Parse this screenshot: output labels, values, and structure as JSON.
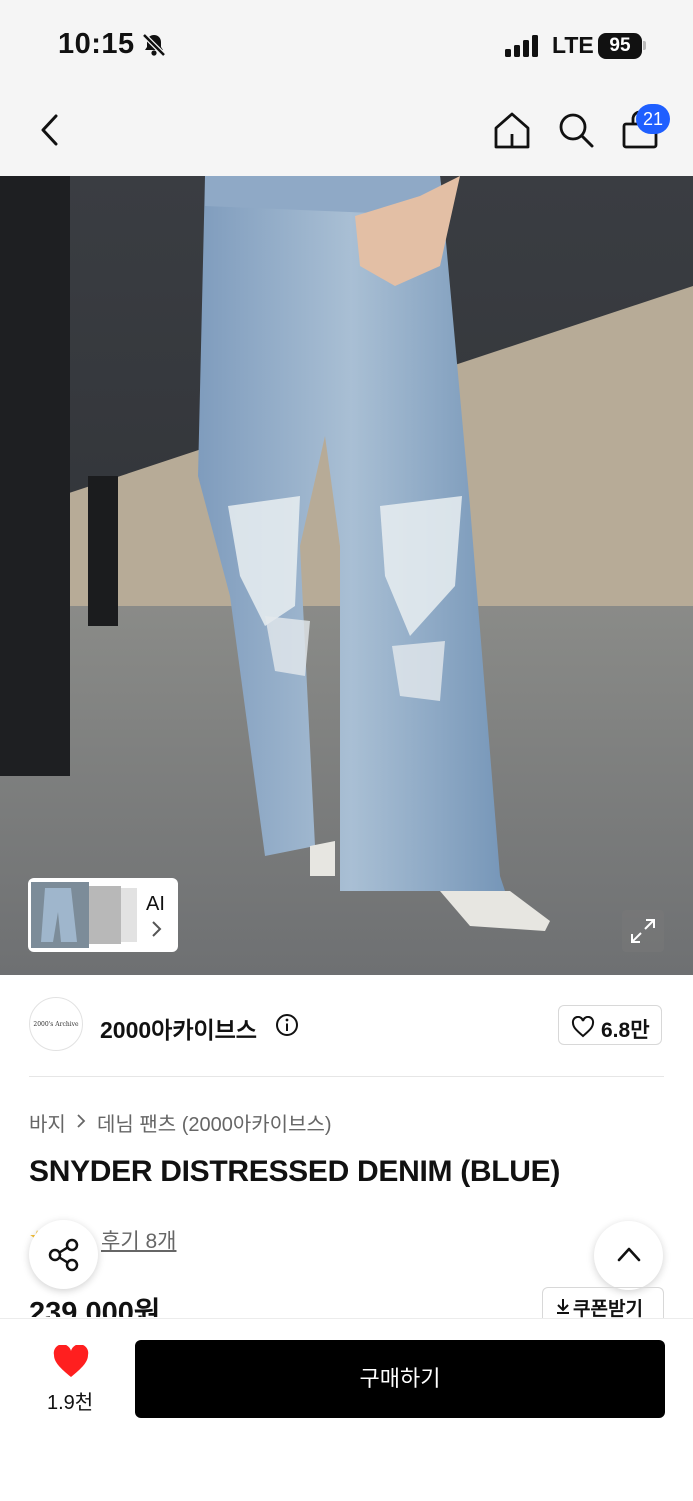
{
  "status_bar": {
    "time": "10:15",
    "network": "LTE",
    "battery": "95"
  },
  "header": {
    "cart_count": "21"
  },
  "gallery": {
    "ai_label": "AI"
  },
  "brand": {
    "logo_text": "2000's Archive",
    "name": "2000아카이브스",
    "like_count": "6.8만"
  },
  "breadcrumb": {
    "items": [
      "바지",
      "데님 팬츠 (2000아카이브스)"
    ]
  },
  "product": {
    "title": "SNYDER DISTRESSED DENIM (BLUE)",
    "review_link": "후기 8개",
    "price": "239,000원",
    "coupon_label": "쿠폰받기"
  },
  "bottom_bar": {
    "wish_count": "1.9천",
    "buy_label": "구매하기"
  },
  "colors": {
    "accent_badge": "#1f5fff",
    "heart": "#ff1f1f",
    "buy_button": "#000000"
  }
}
